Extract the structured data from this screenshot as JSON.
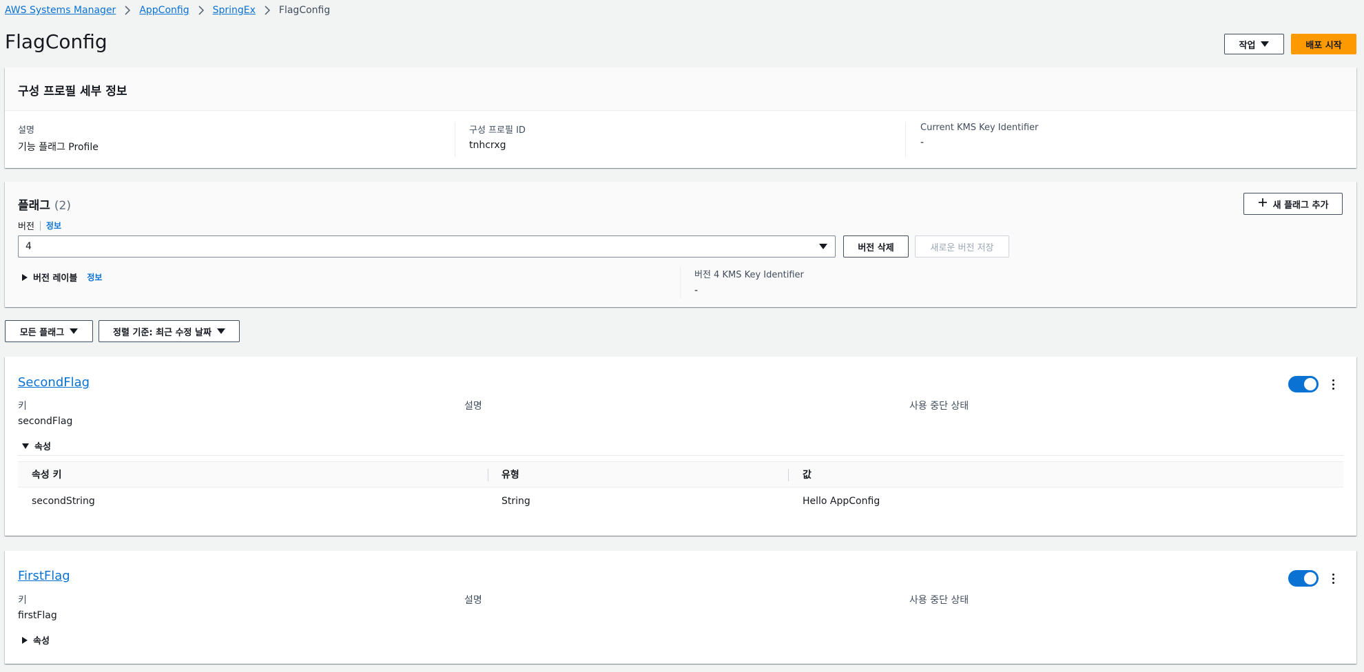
{
  "breadcrumb": {
    "items": [
      "AWS Systems Manager",
      "AppConfig",
      "SpringEx"
    ],
    "current": "FlagConfig"
  },
  "page": {
    "title": "FlagConfig",
    "actions_label": "작업",
    "deploy_label": "배포 시작"
  },
  "details": {
    "title": "구성 프로필 세부 정보",
    "description_label": "설명",
    "description_value": "기능 플래그 Profile",
    "profile_id_label": "구성 프로필 ID",
    "profile_id_value": "tnhcrxg",
    "kms_label": "Current KMS Key Identifier",
    "kms_value": "-"
  },
  "flags": {
    "title": "플래그",
    "count": "(2)",
    "add_label": "새 플래그 추가",
    "version_label": "버전",
    "info_label": "정보",
    "version_value": "4",
    "delete_version_label": "버전 삭제",
    "save_version_label": "새로운 버전 저장",
    "version_labels_label": "버전 레이블",
    "version_kms_label": "버전 4 KMS Key Identifier",
    "version_kms_value": "-"
  },
  "filters": {
    "all_flags": "모든 플래그",
    "sort_by": "정렬 기준: 최근 수정 날짜"
  },
  "flag_cards": [
    {
      "name": "SecondFlag",
      "key_label": "키",
      "key_value": "secondFlag",
      "description_label": "설명",
      "deprecation_label": "사용 중단 상태",
      "attributes_label": "속성",
      "attributes_expanded": true,
      "enabled": true,
      "table_headers": [
        "속성 키",
        "유형",
        "값"
      ],
      "rows": [
        [
          "secondString",
          "String",
          "Hello AppConfig"
        ]
      ]
    },
    {
      "name": "FirstFlag",
      "key_label": "키",
      "key_value": "firstFlag",
      "description_label": "설명",
      "deprecation_label": "사용 중단 상태",
      "attributes_label": "속성",
      "attributes_expanded": false,
      "enabled": true
    }
  ],
  "colors": {
    "accent": "#0972d3",
    "primary_button": "#ff9900",
    "background": "#f2f3f3"
  }
}
